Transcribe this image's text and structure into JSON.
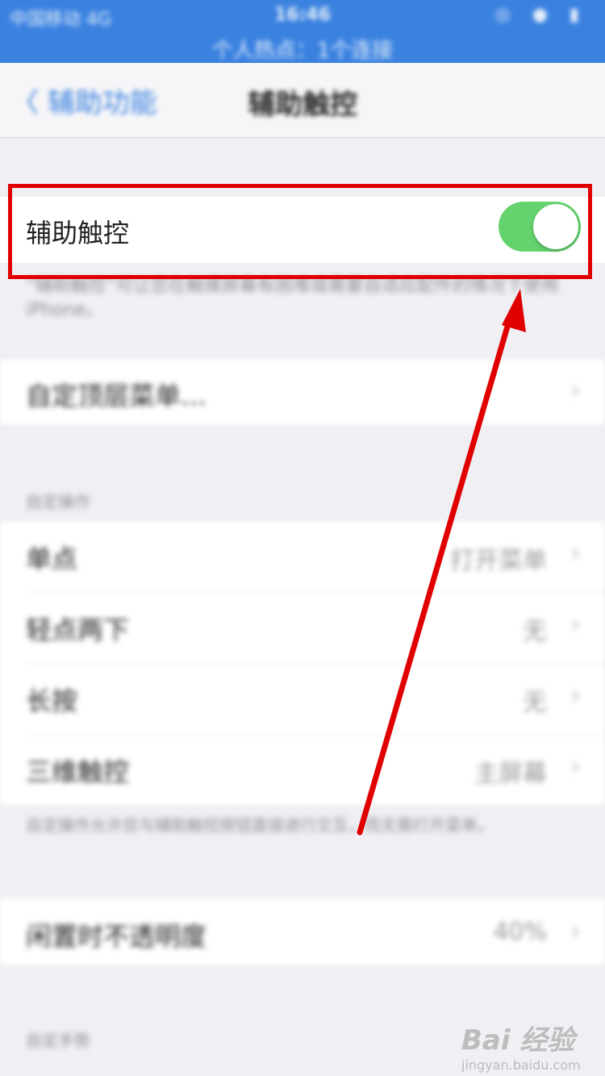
{
  "status_bar": {
    "carrier": "中国移动  4G",
    "time": "16:46",
    "icons": "◎ ● ▮",
    "hotspot": "个人热点：1个连接"
  },
  "nav": {
    "back_label": "〈 辅助功能",
    "title": "辅助触控"
  },
  "assistive_touch": {
    "label": "辅助触控",
    "toggle_on": true,
    "description": "“辅助触控”可让您在触摸屏幕有困难或需要自适应配件的情况下使用 iPhone。"
  },
  "top_menu": {
    "label": "自定顶层菜单…"
  },
  "custom_actions": {
    "header": "自定操作",
    "items": [
      {
        "label": "单点",
        "value": "打开菜单"
      },
      {
        "label": "轻点两下",
        "value": "无"
      },
      {
        "label": "长按",
        "value": "无"
      },
      {
        "label": "三维触控",
        "value": "主屏幕"
      }
    ],
    "footnote": "自定操作允许您与辅助触控按钮直接进行交互，而无需打开菜单。"
  },
  "idle_opacity": {
    "label": "闲置时不透明度",
    "value": "40%"
  },
  "custom_gestures": {
    "header": "自定手势"
  },
  "chevron": "›",
  "watermark": {
    "main": "Bai 经验",
    "sub": "jingyan.baidu.com"
  },
  "colors": {
    "status_bar": "#3b82e0",
    "toggle_on": "#64d36e",
    "highlight": "#e00000",
    "arrow": "#e00000",
    "link": "#3b82e0"
  }
}
